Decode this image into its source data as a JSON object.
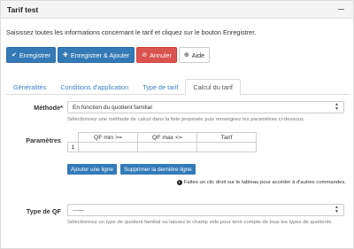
{
  "panel": {
    "title": "Tarif test"
  },
  "intro": "Saisissez toutes les informations concernant le tarif et cliquez sur le bouton Enregistrer.",
  "toolbar": {
    "save": "Enregistrer",
    "save_add": "Enregistrer & Ajouter",
    "cancel": "Annuler",
    "help": "Aide"
  },
  "tabs": [
    {
      "label": "Généralités"
    },
    {
      "label": "Conditions d'application"
    },
    {
      "label": "Type de tarif"
    },
    {
      "label": "Calcul du tarif"
    }
  ],
  "methode": {
    "label": "Méthode*",
    "value": "En fonction du quotient familial",
    "help": "Sélectionnez une méthode de calcul dans la liste proposée puis renseignez les paramètres ci-dessous."
  },
  "parametres": {
    "label": "Paramètres",
    "columns": [
      "QF min >=",
      "QF max <=",
      "Tarif"
    ],
    "rows": [
      {
        "num": "1",
        "cells": [
          "",
          "",
          ""
        ]
      }
    ],
    "add_row": "Ajouter une ligne",
    "delete_row": "Supprimer la dernière ligne",
    "info": "Faites un clic droit sur le tableau pour accéder à d'autres commandes."
  },
  "type_qf": {
    "label": "Type de QF",
    "value": "------",
    "help": "Sélectionnez un type de quotient familial ou laissez le champ vide pour tenir compte de tous les types de quotients."
  },
  "colors": {
    "primary": "#337ab7",
    "danger": "#d9534f",
    "tab_link": "#3b7fc4"
  }
}
